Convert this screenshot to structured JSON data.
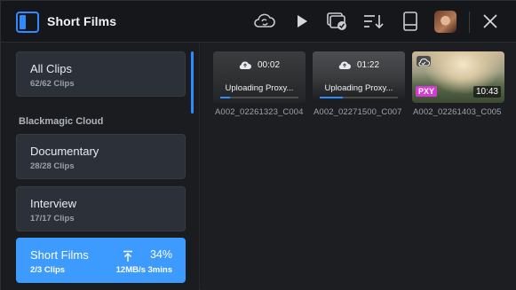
{
  "header": {
    "title": "Short Films",
    "icons": [
      "sidebar-toggle-icon",
      "sync-icon",
      "play-icon",
      "proxy-media-icon",
      "sort-icon",
      "storage-icon",
      "avatar",
      "close-icon"
    ]
  },
  "sidebar": {
    "all_clips": {
      "label": "All Clips",
      "count": "62/62 Clips"
    },
    "section_label": "Blackmagic Cloud",
    "items": [
      {
        "label": "Documentary",
        "count": "28/28 Clips"
      },
      {
        "label": "Interview",
        "count": "17/17 Clips"
      },
      {
        "label": "Short Films",
        "count": "2/3 Clips",
        "upload_percent": "34%",
        "upload_speed": "12MB/s 3mins"
      }
    ]
  },
  "clips": [
    {
      "name": "A002_02261323_C004",
      "duration": "00:02",
      "status": "Uploading Proxy...",
      "progress": 0.12
    },
    {
      "name": "A002_02271500_C007",
      "duration": "01:22",
      "status": "Uploading Proxy...",
      "progress": 0.3
    },
    {
      "name": "A002_02261403_C005",
      "duration": "10:43",
      "badge": "PXY"
    }
  ],
  "colors": {
    "accent": "#2f8cff",
    "active_item": "#3d9bff",
    "proxy_badge": "#d53cd3"
  }
}
